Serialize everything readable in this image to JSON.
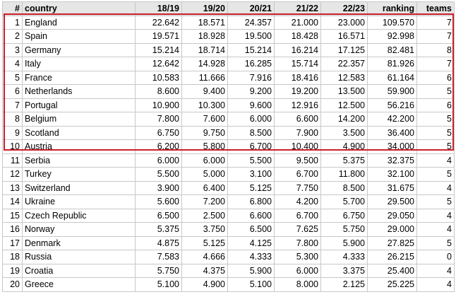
{
  "table": {
    "columns": [
      "#",
      "country",
      "18/19",
      "19/20",
      "20/21",
      "21/22",
      "22/23",
      "ranking",
      "teams"
    ],
    "rows": [
      [
        "1",
        "England",
        "22.642",
        "18.571",
        "24.357",
        "21.000",
        "23.000",
        "109.570",
        "7"
      ],
      [
        "2",
        "Spain",
        "19.571",
        "18.928",
        "19.500",
        "18.428",
        "16.571",
        "92.998",
        "7"
      ],
      [
        "3",
        "Germany",
        "15.214",
        "18.714",
        "15.214",
        "16.214",
        "17.125",
        "82.481",
        "8"
      ],
      [
        "4",
        "Italy",
        "12.642",
        "14.928",
        "16.285",
        "15.714",
        "22.357",
        "81.926",
        "7"
      ],
      [
        "5",
        "France",
        "10.583",
        "11.666",
        "7.916",
        "18.416",
        "12.583",
        "61.164",
        "6"
      ],
      [
        "6",
        "Netherlands",
        "8.600",
        "9.400",
        "9.200",
        "19.200",
        "13.500",
        "59.900",
        "5"
      ],
      [
        "7",
        "Portugal",
        "10.900",
        "10.300",
        "9.600",
        "12.916",
        "12.500",
        "56.216",
        "6"
      ],
      [
        "8",
        "Belgium",
        "7.800",
        "7.600",
        "6.000",
        "6.600",
        "14.200",
        "42.200",
        "5"
      ],
      [
        "9",
        "Scotland",
        "6.750",
        "9.750",
        "8.500",
        "7.900",
        "3.500",
        "36.400",
        "5"
      ],
      [
        "10",
        "Austria",
        "6.200",
        "5.800",
        "6.700",
        "10.400",
        "4.900",
        "34.000",
        "5"
      ],
      [
        "11",
        "Serbia",
        "6.000",
        "6.000",
        "5.500",
        "9.500",
        "5.375",
        "32.375",
        "4"
      ],
      [
        "12",
        "Turkey",
        "5.500",
        "5.000",
        "3.100",
        "6.700",
        "11.800",
        "32.100",
        "5"
      ],
      [
        "13",
        "Switzerland",
        "3.900",
        "6.400",
        "5.125",
        "7.750",
        "8.500",
        "31.675",
        "4"
      ],
      [
        "14",
        "Ukraine",
        "5.600",
        "7.200",
        "6.800",
        "4.200",
        "5.700",
        "29.500",
        "5"
      ],
      [
        "15",
        "Czech Republic",
        "6.500",
        "2.500",
        "6.600",
        "6.700",
        "6.750",
        "29.050",
        "4"
      ],
      [
        "16",
        "Norway",
        "5.375",
        "3.750",
        "6.500",
        "7.625",
        "5.750",
        "29.000",
        "4"
      ],
      [
        "17",
        "Denmark",
        "4.875",
        "5.125",
        "4.125",
        "7.800",
        "5.900",
        "27.825",
        "5"
      ],
      [
        "18",
        "Russia",
        "7.583",
        "4.666",
        "4.333",
        "5.300",
        "4.333",
        "26.215",
        "0"
      ],
      [
        "19",
        "Croatia",
        "5.750",
        "4.375",
        "5.900",
        "6.000",
        "3.375",
        "25.400",
        "4"
      ],
      [
        "20",
        "Greece",
        "5.100",
        "4.900",
        "5.100",
        "8.000",
        "2.125",
        "25.225",
        "4"
      ]
    ],
    "highlight_color": "#cc1f2a"
  }
}
